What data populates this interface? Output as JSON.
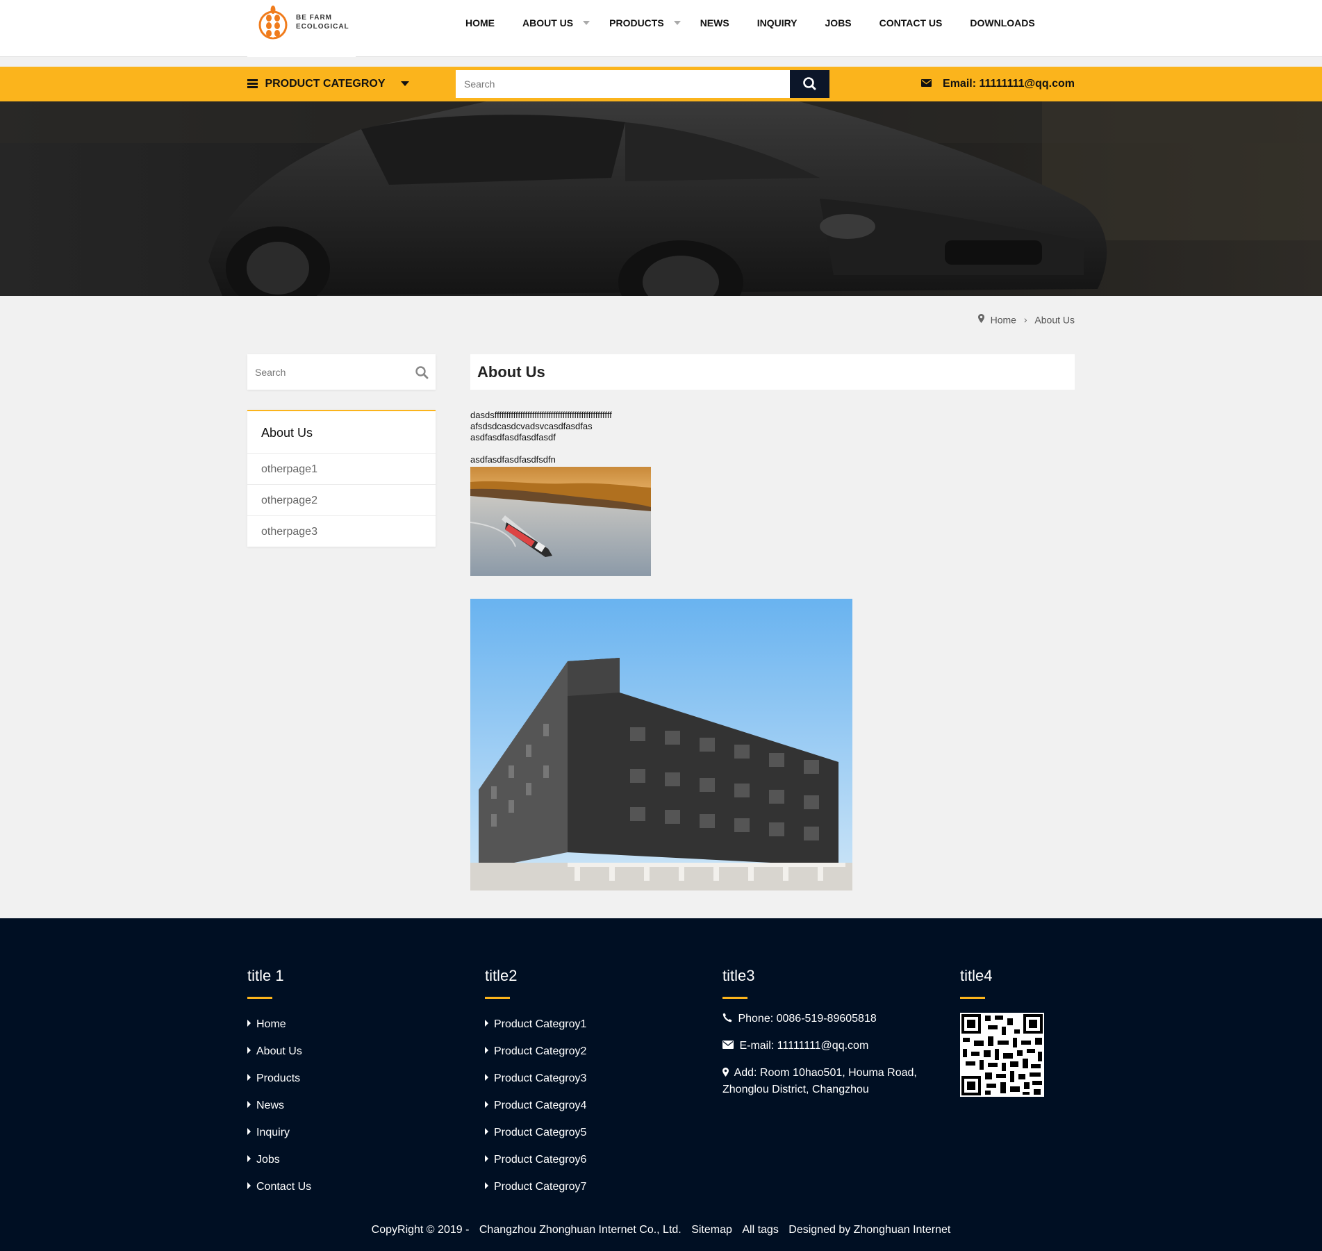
{
  "brand": {
    "line1": "BE FARM",
    "line2": "ECOLOGICAL",
    "accent_color": "#fbb41c",
    "logo_color": "#f07c1c",
    "dark_color": "#000f23"
  },
  "nav": {
    "items": [
      {
        "label": "HOME"
      },
      {
        "label": "ABOUT US"
      },
      {
        "label": "PRODUCTS"
      },
      {
        "label": "NEWS"
      },
      {
        "label": "INQUIRY"
      },
      {
        "label": "JOBS"
      },
      {
        "label": "CONTACT US"
      },
      {
        "label": "DOWNLOADS"
      }
    ]
  },
  "category_bar": {
    "label": "PRODUCT CATEGROY",
    "search_placeholder": "Search",
    "email": "Email: 11111111@qq.com"
  },
  "breadcrumb": {
    "home": "Home",
    "current": "About Us"
  },
  "sidebar": {
    "search_placeholder": "Search",
    "menu_title": "About Us",
    "items": [
      {
        "label": "otherpage1"
      },
      {
        "label": "otherpage2"
      },
      {
        "label": "otherpage3"
      }
    ]
  },
  "content": {
    "title": "About Us",
    "line1": "dasdsffffffffffffffffffffffffffffffffffffffffffffffffff",
    "line2": "afsdsdcasdcvadsvcasdfasdfas",
    "line3": "asdfasdfasdfasdfasdf",
    "line4": "asdfasdfasdfasdfsdfn"
  },
  "footer": {
    "col1": {
      "title": "title 1",
      "links": [
        "Home",
        "About Us",
        "Products",
        "News",
        "Inquiry",
        "Jobs",
        "Contact Us"
      ]
    },
    "col2": {
      "title": "title2",
      "links": [
        "Product Categroy1",
        "Product Categroy2",
        "Product Categroy3",
        "Product Categroy4",
        "Product Categroy5",
        "Product Categroy6",
        "Product Categroy7"
      ]
    },
    "col3": {
      "title": "title3",
      "phone": "Phone: 0086-519-89605818",
      "email": "E-mail: 11111111@qq.com",
      "address": "Add: Room 10hao501, Houma Road, Zhonglou District, Changzhou"
    },
    "col4": {
      "title": "title4"
    },
    "copyright": {
      "text": "CopyRight © 2019 -",
      "company": "Changzhou Zhonghuan Internet Co., Ltd.",
      "sitemap": "Sitemap",
      "alltags": "All tags",
      "designed": "Designed by Zhonghuan Internet"
    }
  }
}
